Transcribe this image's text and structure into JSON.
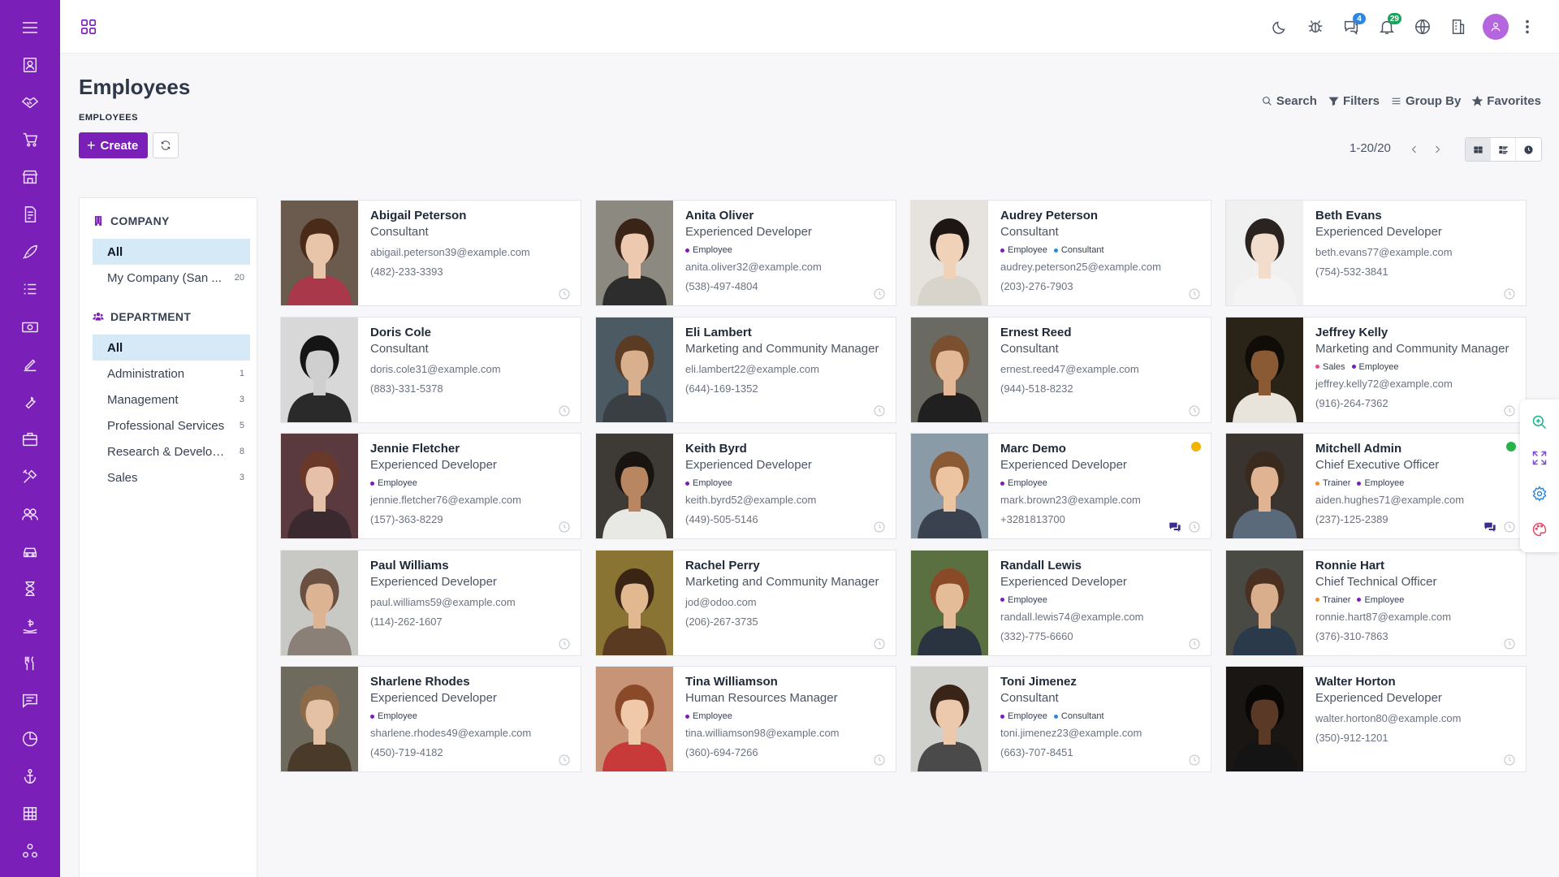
{
  "colors": {
    "brand": "#7a1fb8",
    "active_bg": "#d6e9f6",
    "badge_blue": "#2f86de",
    "badge_green": "#1aa35a",
    "presence_orange": "#f0b400",
    "presence_green": "#27b24a"
  },
  "rail_icons": [
    "menu-icon",
    "contacts-icon",
    "handshake-icon",
    "cart-icon",
    "store-icon",
    "invoice-icon",
    "rocket-icon",
    "tasks-icon",
    "money-icon",
    "sign-icon",
    "wrench-icon",
    "briefcase-icon",
    "tools-icon",
    "employees-icon",
    "car-icon",
    "hourglass-icon",
    "payroll-icon",
    "restaurant-icon",
    "chat-icon",
    "chart-pie-icon",
    "anchor-icon",
    "grid-icon",
    "apps-network-icon"
  ],
  "topbar": {
    "messages_badge": "4",
    "notifications_badge": "29"
  },
  "page": {
    "title": "Employees",
    "breadcrumb": "EMPLOYEES",
    "create_label": "Create"
  },
  "search": {
    "search_label": "Search",
    "filters_label": "Filters",
    "groupby_label": "Group By",
    "favorites_label": "Favorites"
  },
  "pager": {
    "value": "1-20/20"
  },
  "sidepanel": {
    "company": {
      "title": "COMPANY",
      "items": [
        {
          "label": "All",
          "count": ""
        },
        {
          "label": "My Company (San ...",
          "count": "20"
        }
      ]
    },
    "department": {
      "title": "DEPARTMENT",
      "items": [
        {
          "label": "All",
          "count": ""
        },
        {
          "label": "Administration",
          "count": "1"
        },
        {
          "label": "Management",
          "count": "3"
        },
        {
          "label": "Professional Services",
          "count": "5"
        },
        {
          "label": "Research & Develop...",
          "count": "8"
        },
        {
          "label": "Sales",
          "count": "3"
        }
      ]
    }
  },
  "employees": [
    {
      "name": "Abigail Peterson",
      "job": "Consultant",
      "tags": [],
      "email": "abigail.peterson39@example.com",
      "phone": "(482)-233-3393",
      "photo": {
        "bg": "#6b5a4e",
        "skin": "#e8c4a8",
        "hair": "#4a2a18",
        "shirt": "#a8384a"
      }
    },
    {
      "name": "Anita Oliver",
      "job": "Experienced Developer",
      "tags": [
        {
          "label": "Employee",
          "color": "#7a1fb8"
        }
      ],
      "email": "anita.oliver32@example.com",
      "phone": "(538)-497-4804",
      "photo": {
        "bg": "#8c8a80",
        "skin": "#edc9b0",
        "hair": "#3a2418",
        "shirt": "#2d2d2d"
      }
    },
    {
      "name": "Audrey Peterson",
      "job": "Consultant",
      "tags": [
        {
          "label": "Employee",
          "color": "#7a1fb8"
        },
        {
          "label": "Consultant",
          "color": "#2f86de"
        }
      ],
      "email": "audrey.peterson25@example.com",
      "phone": "(203)-276-7903",
      "photo": {
        "bg": "#e6e3de",
        "skin": "#f0d2b8",
        "hair": "#1e1612",
        "shirt": "#d8d4cc"
      }
    },
    {
      "name": "Beth Evans",
      "job": "Experienced Developer",
      "tags": [],
      "email": "beth.evans77@example.com",
      "phone": "(754)-532-3841",
      "photo": {
        "bg": "#f0f0f0",
        "skin": "#f2dccb",
        "hair": "#2a2320",
        "shirt": "#f4f4f4"
      }
    },
    {
      "name": "Doris Cole",
      "job": "Consultant",
      "tags": [],
      "email": "doris.cole31@example.com",
      "phone": "(883)-331-5378",
      "photo": {
        "bg": "#d8d8d8",
        "skin": "#cfcfcf",
        "hair": "#151515",
        "shirt": "#2a2a2a"
      }
    },
    {
      "name": "Eli Lambert",
      "job": "Marketing and Community Manager",
      "tags": [],
      "email": "eli.lambert22@example.com",
      "phone": "(644)-169-1352",
      "photo": {
        "bg": "#4c5a64",
        "skin": "#d9b08e",
        "hair": "#5a3c24",
        "shirt": "#3a3f44"
      }
    },
    {
      "name": "Ernest Reed",
      "job": "Consultant",
      "tags": [],
      "email": "ernest.reed47@example.com",
      "phone": "(944)-518-8232",
      "photo": {
        "bg": "#6a6a62",
        "skin": "#e2b896",
        "hair": "#7a5030",
        "shirt": "#202020"
      }
    },
    {
      "name": "Jeffrey Kelly",
      "job": "Marketing and Community Manager",
      "tags": [
        {
          "label": "Sales",
          "color": "#e64a8a"
        },
        {
          "label": "Employee",
          "color": "#7a1fb8"
        }
      ],
      "email": "jeffrey.kelly72@example.com",
      "phone": "(916)-264-7362",
      "photo": {
        "bg": "#2a2418",
        "skin": "#8a5a34",
        "hair": "#100c08",
        "shirt": "#e8e4dc"
      }
    },
    {
      "name": "Jennie Fletcher",
      "job": "Experienced Developer",
      "tags": [
        {
          "label": "Employee",
          "color": "#7a1fb8"
        }
      ],
      "email": "jennie.fletcher76@example.com",
      "phone": "(157)-363-8229",
      "photo": {
        "bg": "#5a3a3e",
        "skin": "#e6c0a8",
        "hair": "#6a3828",
        "shirt": "#3a2a30"
      }
    },
    {
      "name": "Keith Byrd",
      "job": "Experienced Developer",
      "tags": [
        {
          "label": "Employee",
          "color": "#7a1fb8"
        }
      ],
      "email": "keith.byrd52@example.com",
      "phone": "(449)-505-5146",
      "photo": {
        "bg": "#3e3a36",
        "skin": "#b88660",
        "hair": "#1a1410",
        "shirt": "#e8e8e4"
      }
    },
    {
      "name": "Marc Demo",
      "job": "Experienced Developer",
      "tags": [
        {
          "label": "Employee",
          "color": "#7a1fb8"
        }
      ],
      "email": "mark.brown23@example.com",
      "phone": "+3281813700",
      "presence": "#f0b400",
      "chat": true,
      "photo": {
        "bg": "#8a9aa6",
        "skin": "#edc4a2",
        "hair": "#8a5a34",
        "shirt": "#3a4250"
      }
    },
    {
      "name": "Mitchell Admin",
      "job": "Chief Executive Officer",
      "tags": [
        {
          "label": "Trainer",
          "color": "#f28c28"
        },
        {
          "label": "Employee",
          "color": "#7a1fb8"
        }
      ],
      "email": "aiden.hughes71@example.com",
      "phone": "(237)-125-2389",
      "presence": "#27b24a",
      "chat": true,
      "photo": {
        "bg": "#3a3430",
        "skin": "#e0b492",
        "hair": "#3a2a1e",
        "shirt": "#5a6a7a"
      }
    },
    {
      "name": "Paul Williams",
      "job": "Experienced Developer",
      "tags": [],
      "email": "paul.williams59@example.com",
      "phone": "(114)-262-1607",
      "photo": {
        "bg": "#c8c8c4",
        "skin": "#dcb494",
        "hair": "#6a5040",
        "shirt": "#8a8078"
      }
    },
    {
      "name": "Rachel Perry",
      "job": "Marketing and Community Manager",
      "tags": [],
      "email": "jod@odoo.com",
      "phone": "(206)-267-3735",
      "photo": {
        "bg": "#8a7434",
        "skin": "#e2b890",
        "hair": "#3a2414",
        "shirt": "#5a3a20"
      }
    },
    {
      "name": "Randall Lewis",
      "job": "Experienced Developer",
      "tags": [
        {
          "label": "Employee",
          "color": "#7a1fb8"
        }
      ],
      "email": "randall.lewis74@example.com",
      "phone": "(332)-775-6660",
      "photo": {
        "bg": "#5a7040",
        "skin": "#e4bc98",
        "hair": "#8a4a28",
        "shirt": "#2a3440"
      }
    },
    {
      "name": "Ronnie Hart",
      "job": "Chief Technical Officer",
      "tags": [
        {
          "label": "Trainer",
          "color": "#f28c28"
        },
        {
          "label": "Employee",
          "color": "#7a1fb8"
        }
      ],
      "email": "ronnie.hart87@example.com",
      "phone": "(376)-310-7863",
      "photo": {
        "bg": "#4a4a44",
        "skin": "#d8ae8c",
        "hair": "#4a3020",
        "shirt": "#2a3a4a"
      }
    },
    {
      "name": "Sharlene Rhodes",
      "job": "Experienced Developer",
      "tags": [
        {
          "label": "Employee",
          "color": "#7a1fb8"
        }
      ],
      "email": "sharlene.rhodes49@example.com",
      "phone": "(450)-719-4182",
      "photo": {
        "bg": "#6e6a5e",
        "skin": "#e4c0a4",
        "hair": "#8a6a48",
        "shirt": "#4a3a2a"
      }
    },
    {
      "name": "Tina Williamson",
      "job": "Human Resources Manager",
      "tags": [
        {
          "label": "Employee",
          "color": "#7a1fb8"
        }
      ],
      "email": "tina.williamson98@example.com",
      "phone": "(360)-694-7266",
      "photo": {
        "bg": "#c89478",
        "skin": "#f0c8aa",
        "hair": "#8a4a2a",
        "shirt": "#c83a3a"
      }
    },
    {
      "name": "Toni Jimenez",
      "job": "Consultant",
      "tags": [
        {
          "label": "Employee",
          "color": "#7a1fb8"
        },
        {
          "label": "Consultant",
          "color": "#2f86de"
        }
      ],
      "email": "toni.jimenez23@example.com",
      "phone": "(663)-707-8451",
      "photo": {
        "bg": "#cfcfcc",
        "skin": "#ecc8ac",
        "hair": "#3a2418",
        "shirt": "#4a4a4a"
      }
    },
    {
      "name": "Walter Horton",
      "job": "Experienced Developer",
      "tags": [],
      "email": "walter.horton80@example.com",
      "phone": "(350)-912-1201",
      "photo": {
        "bg": "#1a1614",
        "skin": "#5a3a26",
        "hair": "#0a0806",
        "shirt": "#141414"
      }
    }
  ]
}
